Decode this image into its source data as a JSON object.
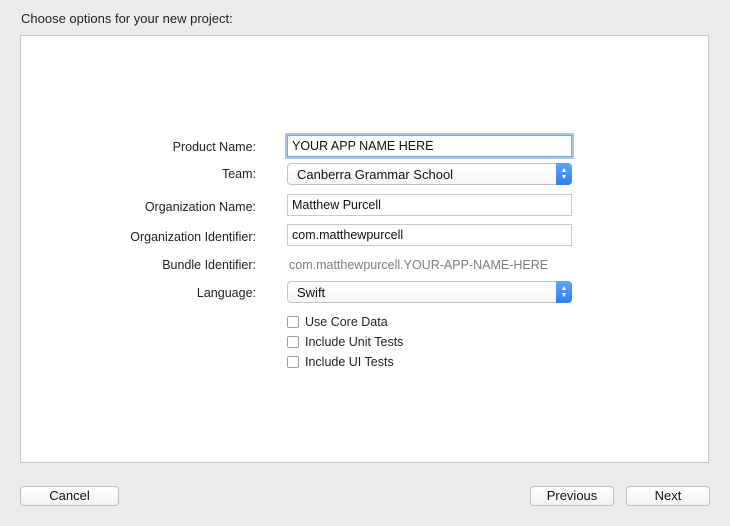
{
  "header": {
    "title": "Choose options for your new project:"
  },
  "form": {
    "product_name_label": "Product Name:",
    "product_name_value": "YOUR APP NAME HERE",
    "team_label": "Team:",
    "team_value": "Canberra Grammar School",
    "organization_name_label": "Organization Name:",
    "organization_name_value": "Matthew Purcell",
    "organization_identifier_label": "Organization Identifier:",
    "organization_identifier_value": "com.matthewpurcell",
    "bundle_identifier_label": "Bundle Identifier:",
    "bundle_identifier_value": "com.matthewpurcell.YOUR-APP-NAME-HERE",
    "language_label": "Language:",
    "language_value": "Swift",
    "checkboxes": [
      {
        "label": "Use Core Data",
        "checked": false
      },
      {
        "label": "Include Unit Tests",
        "checked": false
      },
      {
        "label": "Include UI Tests",
        "checked": false
      }
    ]
  },
  "buttons": {
    "cancel": "Cancel",
    "previous": "Previous",
    "next": "Next"
  },
  "icons": {
    "popup": "up-down-chevron-icon",
    "checkbox": "checkbox-icon"
  },
  "colors": {
    "accent": "#3b86f5",
    "focus_ring": "#a6c5f2",
    "secondary_text": "#7d7d7d"
  }
}
